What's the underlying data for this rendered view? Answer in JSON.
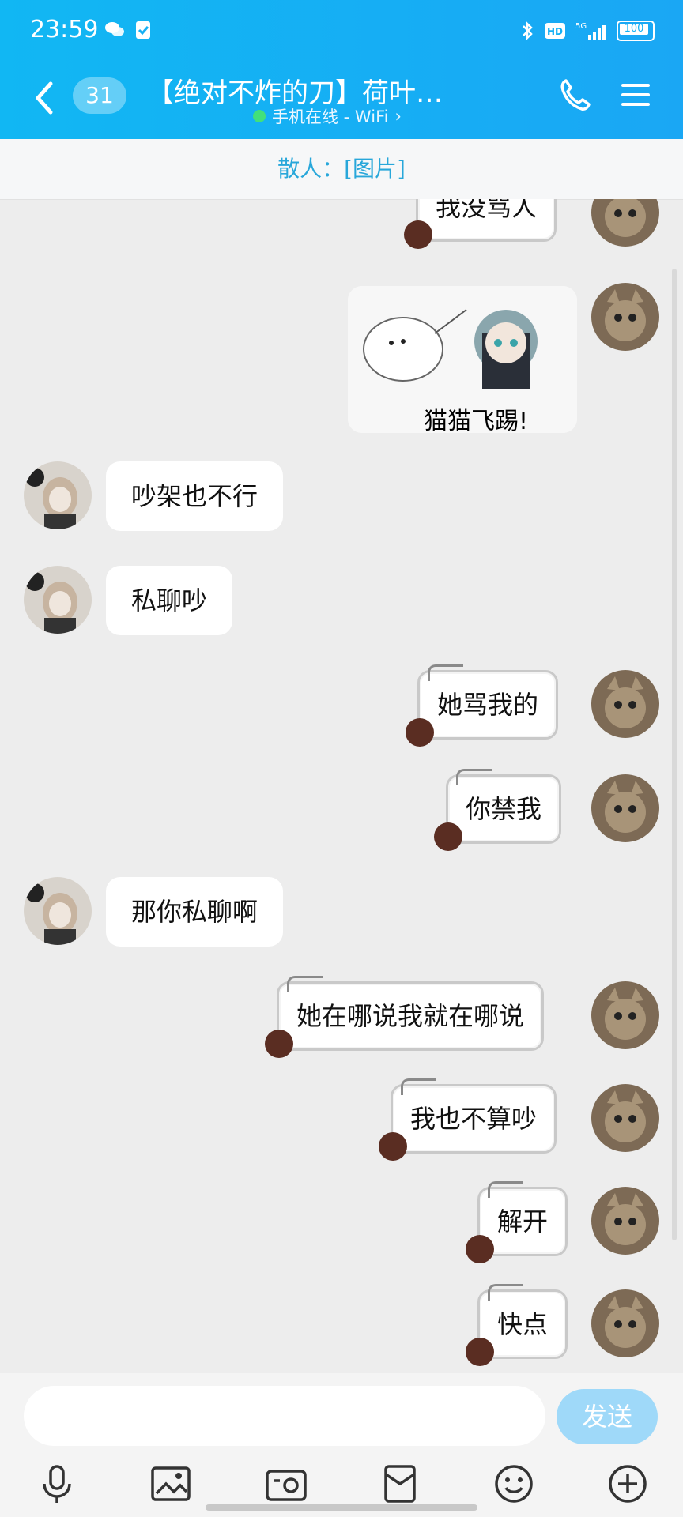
{
  "status_bar": {
    "time": "23:59",
    "battery": "100",
    "network": "5G"
  },
  "header": {
    "unread_count": "31",
    "title": "【绝对不炸的刀】荷叶…",
    "subtitle": "手机在线 - WiFi",
    "subtitle_chevron": "›"
  },
  "pinned": {
    "text": "散人：[图片]"
  },
  "messages": [
    {
      "side": "right",
      "text": "我没骂人"
    },
    {
      "side": "right",
      "image_caption": "猫猫飞踢!"
    },
    {
      "side": "left",
      "text": "吵架也不行"
    },
    {
      "side": "left",
      "text": "私聊吵"
    },
    {
      "side": "right",
      "text": "她骂我的"
    },
    {
      "side": "right",
      "text": "你禁我"
    },
    {
      "side": "left",
      "text": "那你私聊啊"
    },
    {
      "side": "right",
      "text": "她在哪说我就在哪说"
    },
    {
      "side": "right",
      "text": "我也不算吵"
    },
    {
      "side": "right",
      "text": "解开"
    },
    {
      "side": "right",
      "text": "快点"
    }
  ],
  "input": {
    "placeholder": "",
    "send_label": "发送"
  },
  "toolbar": {
    "icons": [
      "microphone-icon",
      "image-icon",
      "camera-icon",
      "red-packet-icon",
      "emoji-icon",
      "plus-icon"
    ]
  },
  "colors": {
    "header": "#14b0f4",
    "send": "#9fd9f9",
    "pin_text": "#28a7da"
  }
}
